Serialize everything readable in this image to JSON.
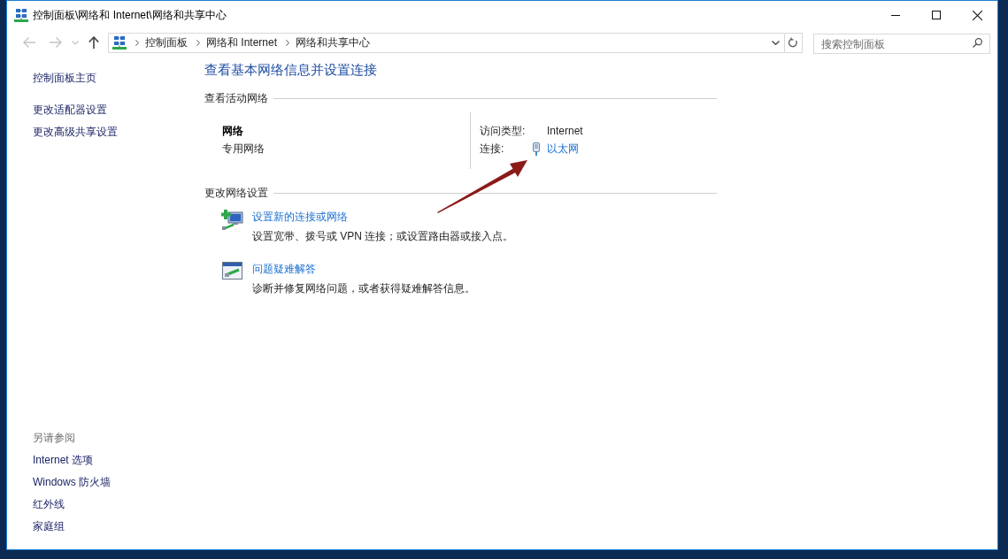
{
  "window": {
    "title": "控制面板\\网络和 Internet\\网络和共享中心"
  },
  "nav": [
    {
      "kind": "back",
      "disabled": true
    },
    {
      "kind": "forward",
      "disabled": true
    },
    {
      "kind": "recent",
      "disabled": true
    },
    {
      "kind": "up",
      "disabled": false
    }
  ],
  "address_bar": {
    "breadcrumbs": [
      "控制面板",
      "网络和 Internet",
      "网络和共享中心"
    ]
  },
  "search": {
    "placeholder": "搜索控制面板"
  },
  "sidebar": {
    "home_link": "控制面板主页",
    "task_links": [
      "更改适配器设置",
      "更改高级共享设置"
    ],
    "see_also": {
      "title": "另请参阅",
      "links": [
        "Internet 选项",
        "Windows 防火墙",
        "红外线",
        "家庭组"
      ]
    }
  },
  "main": {
    "title": "查看基本网络信息并设置连接",
    "active_networks": {
      "heading": "查看活动网络",
      "network": {
        "name": "网络",
        "category": "专用网络"
      },
      "access_type": {
        "label": "访问类型:",
        "value": "Internet"
      },
      "connection": {
        "label": "连接:",
        "value": "以太网"
      }
    },
    "change_settings": {
      "heading": "更改网络设置",
      "tasks": [
        {
          "kind": "new_connection",
          "link": "设置新的连接或网络",
          "description": "设置宽带、拨号或 VPN 连接；或设置路由器或接入点。"
        },
        {
          "kind": "troubleshoot",
          "link": "问题疑难解答",
          "description": "诊断并修复网络问题，或者获得疑难解答信息。"
        }
      ]
    }
  }
}
